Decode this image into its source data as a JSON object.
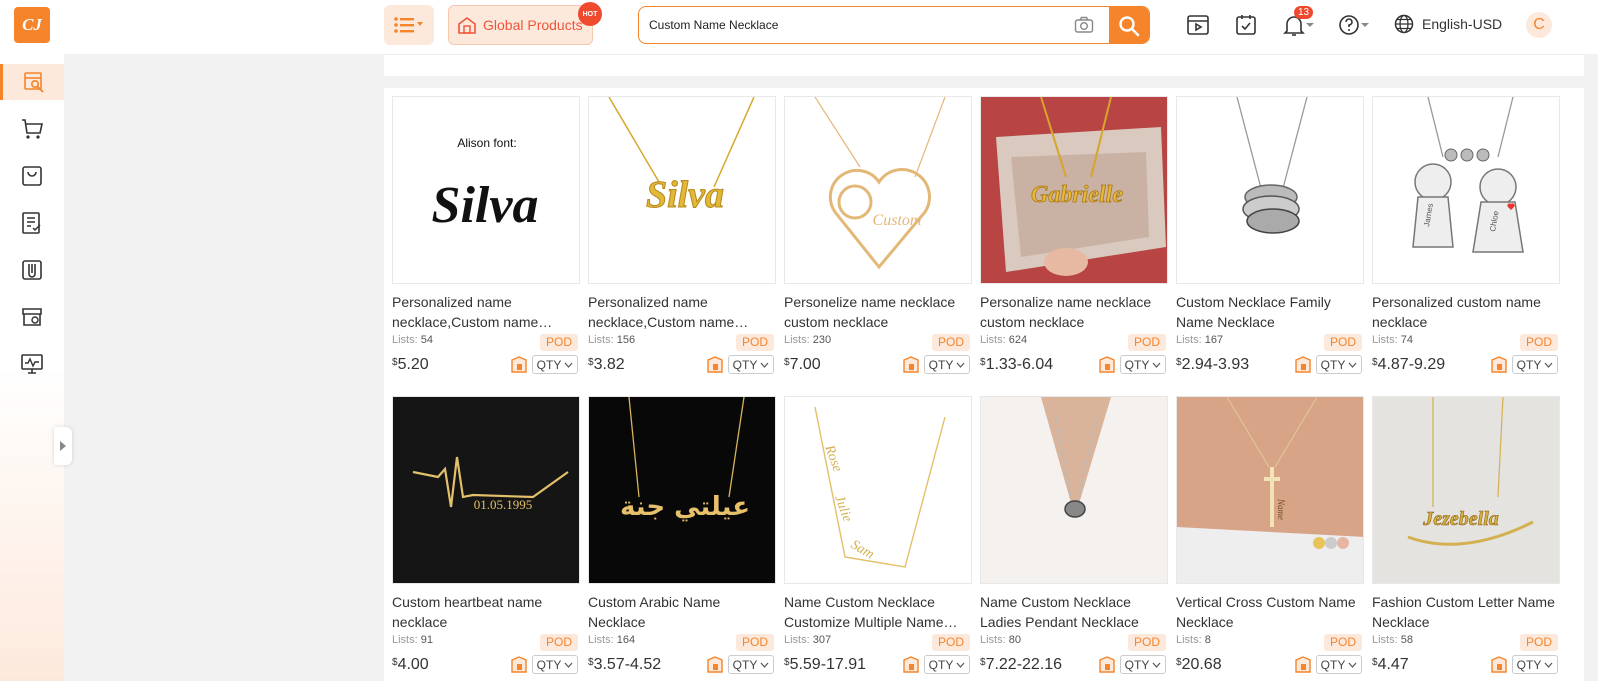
{
  "logo": {
    "text": "CJ"
  },
  "header": {
    "global_products": "Global Products",
    "hot_badge": "HOT",
    "search_value": "Custom Name Necklace",
    "notification_count": "13",
    "language": "English-USD",
    "avatar_letter": "C"
  },
  "colors": {
    "accent": "#f5842a",
    "pod_bg": "#fde9dc",
    "badge": "#f04a2e"
  },
  "sidebar": {
    "items": [
      {
        "icon": "product-search-icon"
      },
      {
        "icon": "cart-icon"
      },
      {
        "icon": "bag-icon"
      },
      {
        "icon": "orders-icon"
      },
      {
        "icon": "clip-icon"
      },
      {
        "icon": "store-icon"
      },
      {
        "icon": "monitor-icon"
      }
    ]
  },
  "labels": {
    "lists": "Lists:",
    "pod": "POD",
    "qty": "QTY",
    "currency": "$"
  },
  "products": [
    {
      "title": "Personalized name necklace,Custom name necklace",
      "lists": "54",
      "price": "5.20",
      "img_text": "Silva",
      "img_caption": "Alison font:"
    },
    {
      "title": "Personalized name necklace,Custom name necklace",
      "lists": "156",
      "price": "3.82",
      "img_text": "Silva"
    },
    {
      "title": "Personelize name necklace custom necklace",
      "lists": "230",
      "price": "7.00",
      "img_text": "Custom"
    },
    {
      "title": "Personalize name necklace custom necklace",
      "lists": "624",
      "price": "1.33-6.04",
      "img_text": "Gabrielle"
    },
    {
      "title": "Custom Necklace Family Name Necklace",
      "lists": "167",
      "price": "2.94-3.93"
    },
    {
      "title": "Personalized custom name necklace",
      "lists": "74",
      "price": "4.87-9.29",
      "img_text": "James",
      "img_text2": "Chloe"
    },
    {
      "title": "Custom heartbeat name necklace",
      "lists": "91",
      "price": "4.00",
      "img_text": "01.05.1995"
    },
    {
      "title": "Custom Arabic Name Necklace",
      "lists": "164",
      "price": "3.57-4.52",
      "img_text": "عيلتي جنة"
    },
    {
      "title": "Name Custom Necklace Customize Multiple Name Necklace",
      "lists": "307",
      "price": "5.59-17.91",
      "img_text": "Rose",
      "img_text2": "Julie",
      "img_text3": "Sam"
    },
    {
      "title": "Name Custom Necklace Ladies Pendant Necklace",
      "lists": "80",
      "price": "7.22-22.16"
    },
    {
      "title": "Vertical Cross Custom Name Necklace",
      "lists": "8",
      "price": "20.68",
      "img_text": "Name"
    },
    {
      "title": "Fashion Custom Letter Name Necklace",
      "lists": "58",
      "price": "4.47",
      "img_text": "Jezebella"
    }
  ]
}
